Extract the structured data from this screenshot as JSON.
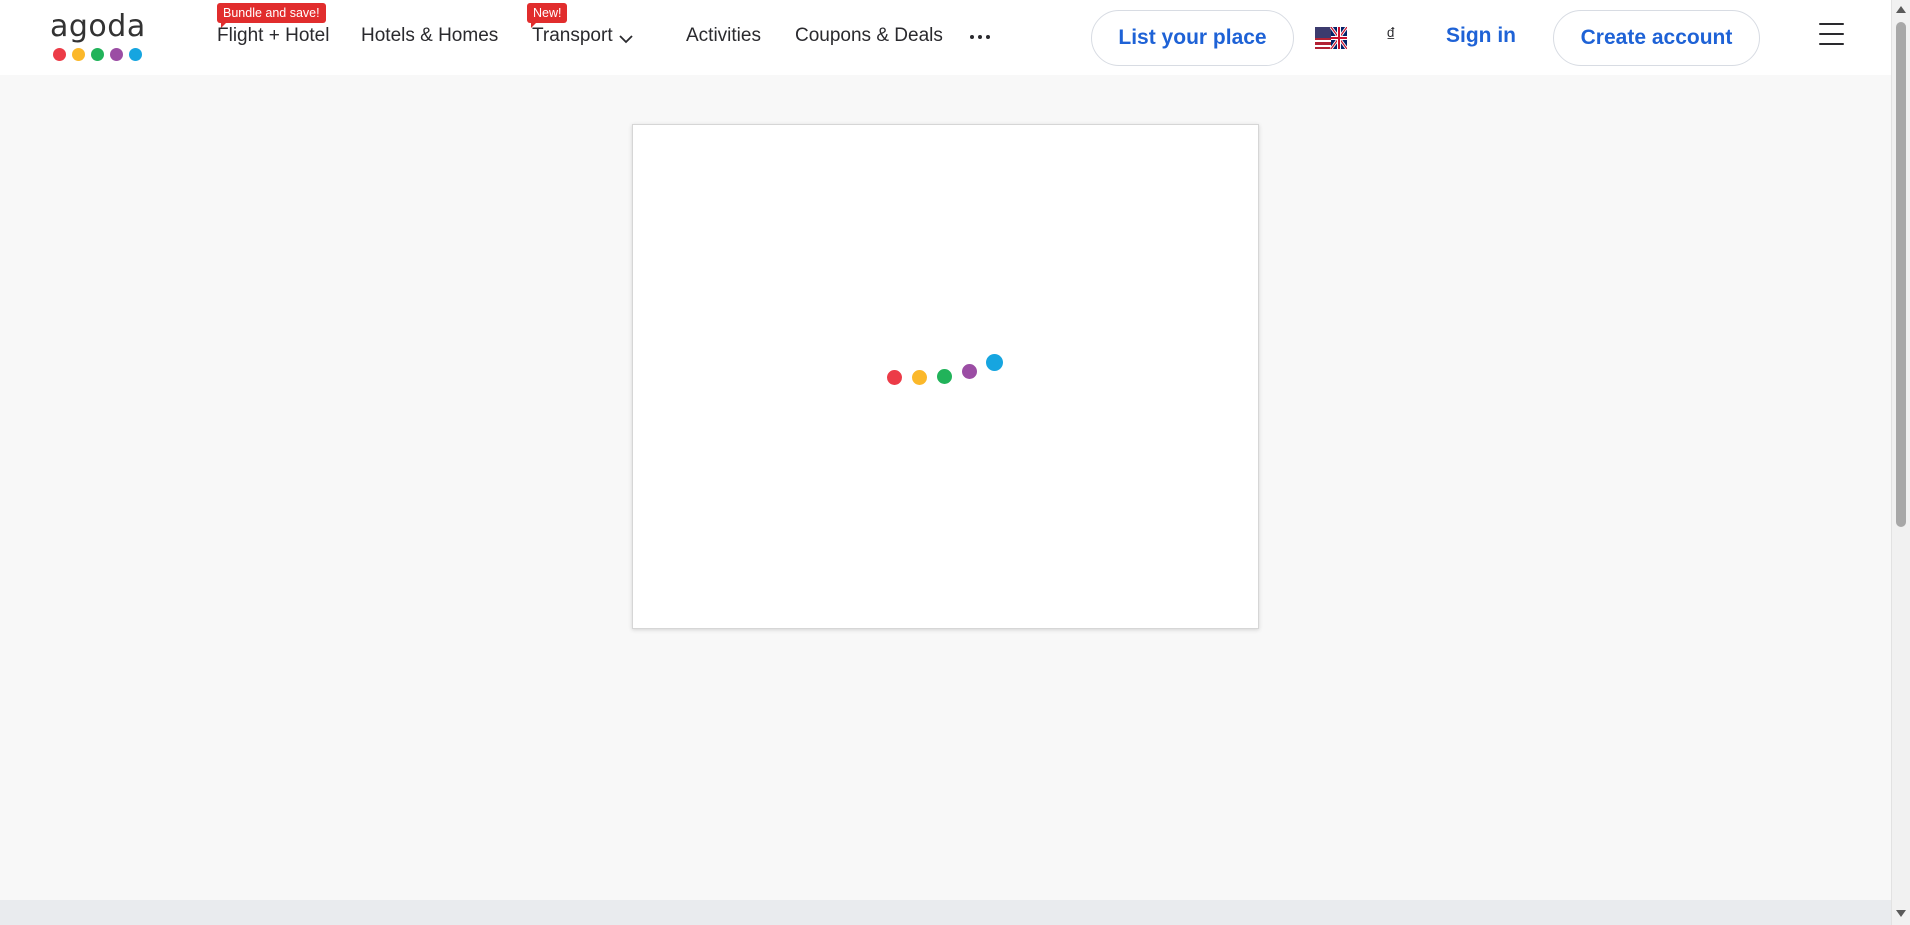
{
  "brand": {
    "logo_text": "agoda",
    "dot_colors": [
      "#ec3b47",
      "#fbb82a",
      "#21b35a",
      "#9b4da4",
      "#16a5e0"
    ]
  },
  "nav": {
    "flight_hotel": {
      "label": "Flight + Hotel",
      "badge": "Bundle and save!"
    },
    "hotels_homes": {
      "label": "Hotels & Homes"
    },
    "transport": {
      "label": "Transport",
      "badge": "New!",
      "icon": "chevron-down-icon"
    },
    "activities": {
      "label": "Activities"
    },
    "coupons": {
      "label": "Coupons & Deals"
    },
    "more": {
      "icon": "more-horizontal-icon"
    }
  },
  "actions": {
    "list_place": "List your place",
    "language_flag": "uk-us-flag-icon",
    "currency_symbol": "₫",
    "sign_in": "Sign in",
    "create_account": "Create account",
    "menu_icon": "hamburger-menu-icon"
  },
  "loader": {
    "icon": "loading-dots-icon",
    "colors": [
      "#ec3b47",
      "#fbb82a",
      "#21b35a",
      "#9b4da4",
      "#16a5e0"
    ]
  },
  "colors": {
    "accent_blue": "#1e62d6",
    "badge_red": "#e12d2d",
    "page_bg": "#f8f8f8"
  }
}
